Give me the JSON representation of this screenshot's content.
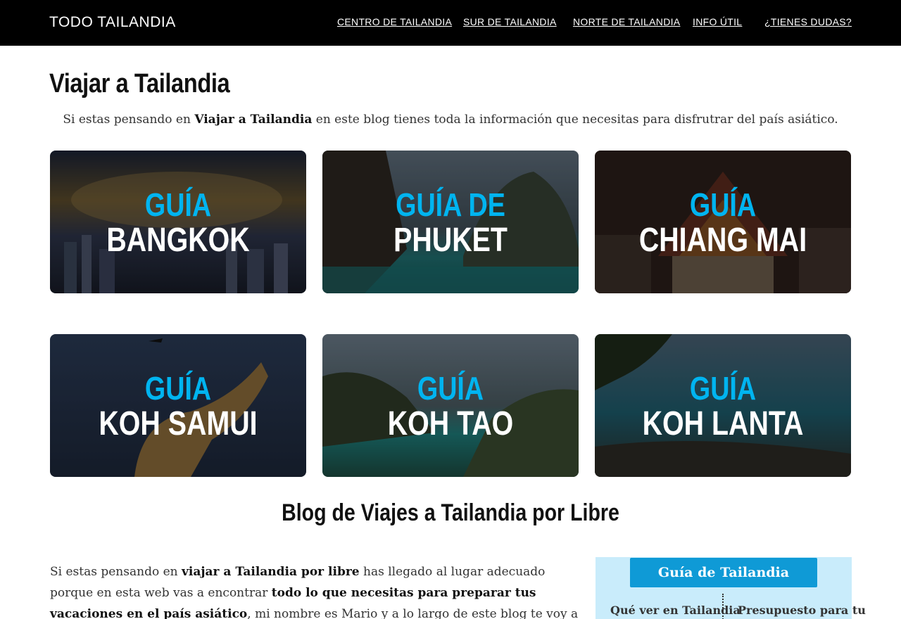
{
  "header": {
    "brand": "TODO TAILANDIA",
    "nav": [
      {
        "label": "CENTRO DE TAILANDIA"
      },
      {
        "label": "SUR DE TAILANDIA"
      },
      {
        "label": "NORTE DE TAILANDIA"
      },
      {
        "label": "INFO ÚTIL"
      },
      {
        "label": "¿TIENES DUDAS?"
      }
    ]
  },
  "main": {
    "title": "Viajar a Tailandia",
    "intro": {
      "before": "Si estas pensando en ",
      "bold": "Viajar a Tailandia",
      "after": " en este blog tienes toda la información que necesitas para disfrutrar del país asiático."
    },
    "guides": [
      {
        "top_line": "GUÍA",
        "bottom_line": "BANGKOK"
      },
      {
        "top_line": "GUÍA DE",
        "bottom_line": "PHUKET"
      },
      {
        "top_line": "GUÍA",
        "bottom_line": "CHIANG MAI"
      },
      {
        "top_line": "GUÍA",
        "bottom_line": "KOH SAMUI"
      },
      {
        "top_line": "GUÍA",
        "bottom_line": "KOH TAO"
      },
      {
        "top_line": "GUÍA",
        "bottom_line": "KOH LANTA"
      }
    ],
    "section_title": "Blog de Viajes a Tailandia por Libre",
    "body": {
      "p1": "Si estas pensando en ",
      "b1": "viajar a Tailandia por libre",
      "p2": " has llegado al lugar adecuado porque en esta web vas a encontrar ",
      "b2": "todo lo que necesitas para preparar tus vacaciones en el país asiático",
      "p3": ", mi nombre es Mario y a lo largo de este blog te voy a acompañar ayudándote en"
    }
  },
  "sidebar": {
    "button_label": "Guía de Tailandia",
    "links": [
      {
        "label": "Qué ver en Tailandia"
      },
      {
        "label": "Presupuesto para tu"
      }
    ]
  },
  "colors": {
    "header_bg": "#000000",
    "accent_blue": "#00b4f0",
    "button_blue": "#0f9ad6",
    "box_bg": "#c9ecfb"
  }
}
